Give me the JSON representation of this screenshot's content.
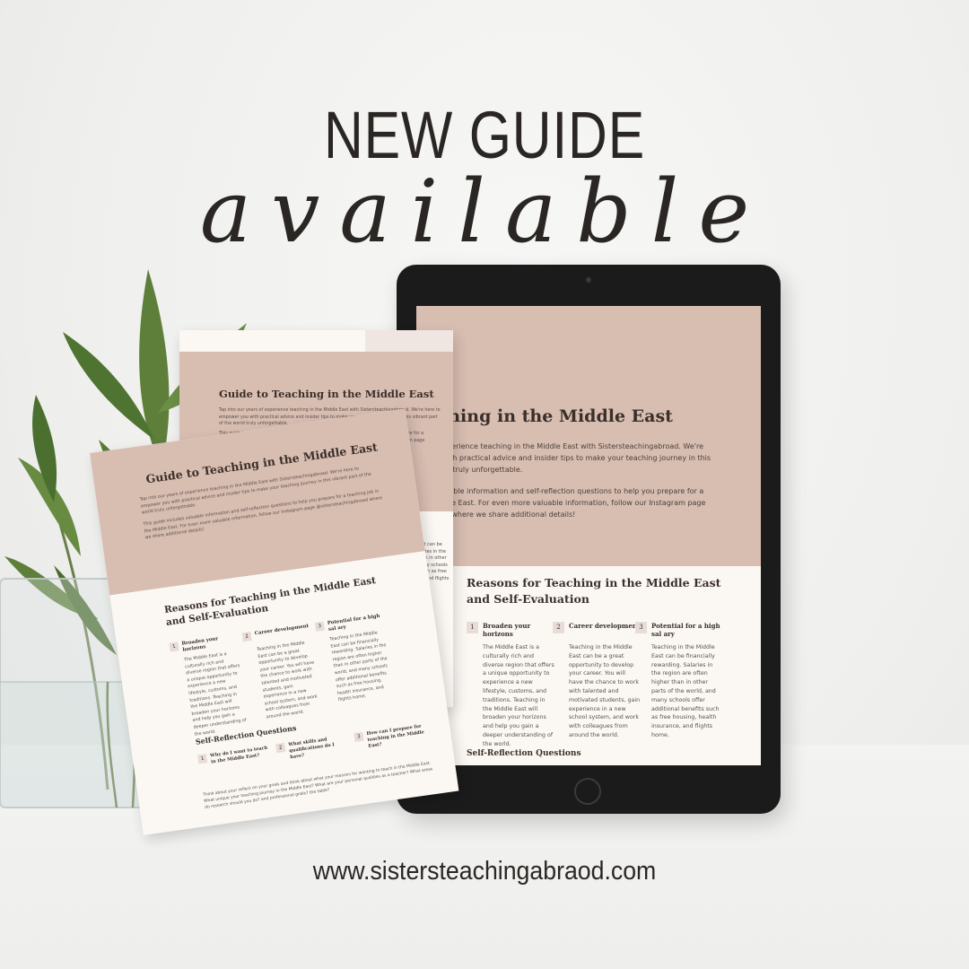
{
  "headline": "NEW GUIDE",
  "script_word": "available",
  "url": "www.sistersteachingabraod.com",
  "colors": {
    "accent_band": "#d8bdb1",
    "paper": "#fbf8f4",
    "ink": "#2a2623"
  },
  "guide": {
    "title": "Guide to Teaching in the Middle East",
    "intro_1": "Tap into our years of experience teaching in the Middle East with Sistersteachingabroad. We're here to empower you with practical advice and insider tips to make your teaching journey in this vibrant part of the world truly unforgettable.",
    "intro_2": "This guide includes valuable information and self-reflection questions to help you prepare for a teaching job in the Middle East. For even more valuable information, follow our Instagram page @sistersteachingabroad where we share additional details!",
    "section_title": "Reasons for Teaching in the Middle East and Self-Evaluation",
    "reasons": [
      {
        "num": "1",
        "title": "Broaden your horizons",
        "body": "The Middle East is a culturally rich and diverse region that offers a unique opportunity to experience a new lifestyle, customs, and traditions. Teaching in the Middle East will broaden your horizons and help you gain a deeper understanding of the world."
      },
      {
        "num": "2",
        "title": "Career development",
        "body": "Teaching in the Middle East can be a great opportunity to develop your career. You will have the chance to work with talented and motivated students, gain experience in a new school system, and work with colleagues from around the world."
      },
      {
        "num": "3",
        "title": "Potential for a high sal ary",
        "body": "Teaching in the Middle East can be financially rewarding. Salaries in the region are often higher than in other parts of the world, and many schools offer additional benefits such as free housing, health insurance, and flights home."
      }
    ],
    "self_reflection_title": "Self-Reflection Questions",
    "questions": [
      {
        "num": "1",
        "title": "Why do I want to teach in the Middle East?"
      },
      {
        "num": "2",
        "title": "What skills and qualifications do I have?"
      },
      {
        "num": "3",
        "title": "How can I prepare for teaching in the Middle East?"
      }
    ],
    "footer_text": "Think about your reflect on your goals and think about what your reasons for wanting to teach in the Middle East. What unique your teaching journey in the Middle East? What are your personal qualities as a teacher? What areas do research should you do? and professional goals? the table?"
  }
}
